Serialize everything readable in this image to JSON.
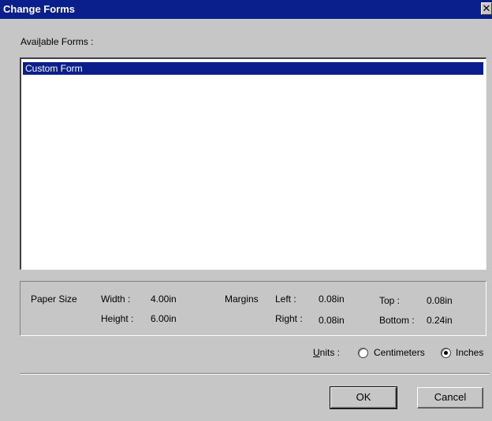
{
  "window": {
    "title": "Change Forms",
    "close_glyph": "✕"
  },
  "forms": {
    "label_prefix": "Avai",
    "label_accel": "l",
    "label_suffix": "able Forms :",
    "items": [
      {
        "label": "Custom Form",
        "selected": true
      }
    ]
  },
  "paper_size": {
    "label": "Paper Size",
    "width_label": "Width :",
    "width_value": "4.00in",
    "height_label": "Height :",
    "height_value": "6.00in"
  },
  "margins": {
    "label": "Margins",
    "left_label": "Left :",
    "left_value": "0.08in",
    "right_label": "Right :",
    "right_value": "0.08in",
    "top_label": "Top :",
    "top_value": "0.08in",
    "bottom_label": "Bottom :",
    "bottom_value": "0.24in"
  },
  "units": {
    "label_accel": "U",
    "label_suffix": "nits :",
    "options": [
      {
        "label": "Centimeters",
        "selected": false
      },
      {
        "label": "Inches",
        "selected": true
      }
    ]
  },
  "buttons": {
    "ok_label": "OK",
    "cancel_label": "Cancel"
  },
  "colors": {
    "title_bar": "#0a1e8c",
    "dialog_face": "#c6c6c6",
    "selection": "#0a1e8c"
  }
}
